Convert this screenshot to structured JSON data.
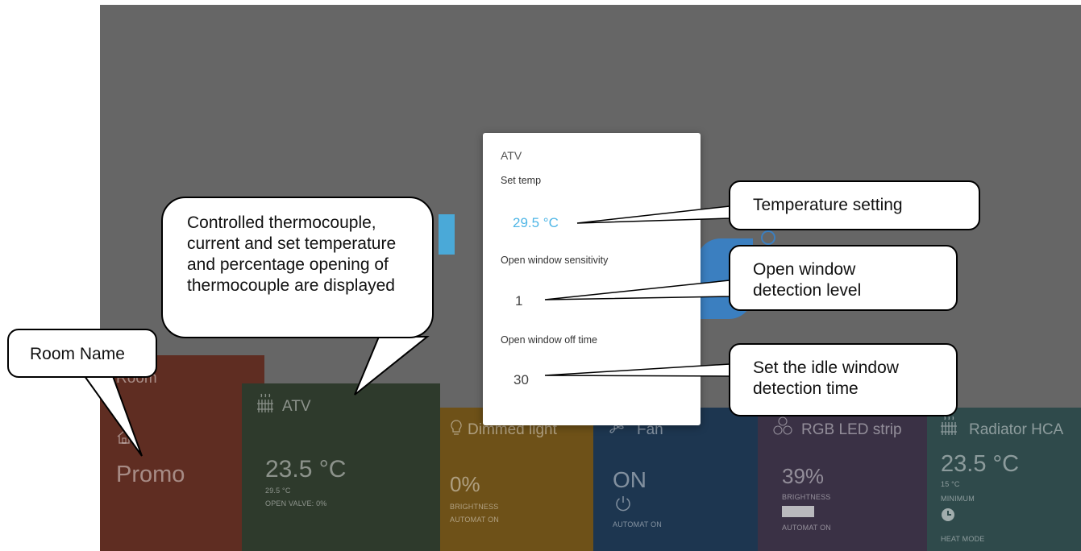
{
  "dialog": {
    "title": "ATV",
    "set_temp_label": "Set temp",
    "set_temp_value": "29.5 °C",
    "sensitivity_label": "Open window sensitivity",
    "sensitivity_value": "1",
    "off_time_label": "Open window off time",
    "off_time_value": "30"
  },
  "tiles": {
    "room": {
      "header": "Room",
      "name": "Promo",
      "color": "#5f2d22"
    },
    "atv": {
      "name": "ATV",
      "current": "23.5 °C",
      "set": "29.5 °C",
      "valve": "OPEN VALVE: 0%",
      "color": "#2e3a2c"
    },
    "dimmed": {
      "name": "Dimmed light",
      "value": "0%",
      "line1": "BRIGHTNESS",
      "line2": "AUTOMAT ON",
      "color": "#6e5118"
    },
    "fan": {
      "name": "Fan",
      "value": "ON",
      "line2": "AUTOMAT ON",
      "color": "#1d3650"
    },
    "rgb": {
      "name": "RGB LED strip",
      "value": "39%",
      "line1": "BRIGHTNESS",
      "line2": "AUTOMAT ON",
      "color": "#3a3145"
    },
    "radiator": {
      "name": "Radiator HCA",
      "current": "23.5 °C",
      "set": "15 °C",
      "line1": "MINIMUM",
      "line2": "HEAT MODE",
      "color": "#2f4a4b"
    }
  },
  "callouts": {
    "thermo": [
      "Controlled thermocouple,",
      "current and set temperature",
      "and percentage opening of",
      "thermocouple  are displayed"
    ],
    "room_name": "Room Name",
    "temp_setting": "Temperature setting",
    "open_window": [
      "Open window",
      "detection level"
    ],
    "idle": [
      "Set the idle window",
      "detection time"
    ]
  },
  "colors": {
    "accent": "#4fb6e6",
    "background": "#666666"
  }
}
